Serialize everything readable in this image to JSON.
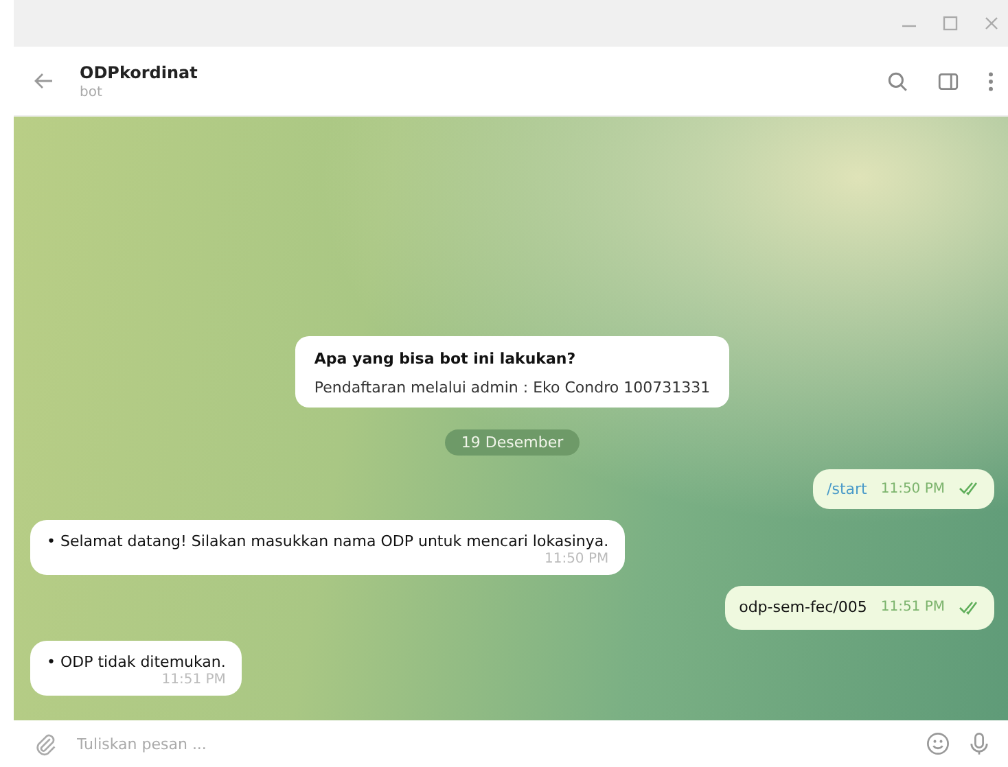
{
  "chat": {
    "name": "ODPkordinat",
    "status": "bot"
  },
  "intro": {
    "title": "Apa yang bisa bot ini lakukan?",
    "text": "Pendaftaran melalui admin : Eko Condro 100731331"
  },
  "date": "19 Desember",
  "messages": [
    {
      "kind": "out",
      "text": "/start",
      "time": "11:50 PM",
      "read": true,
      "command": true
    },
    {
      "kind": "in",
      "text": "• Selamat datang! Silakan masukkan nama ODP untuk mencari lokasinya.",
      "time": "11:50 PM"
    },
    {
      "kind": "out",
      "text": "odp-sem-fec/005",
      "time": "11:51 PM",
      "read": true,
      "command": false
    },
    {
      "kind": "in",
      "text": "• ODP tidak ditemukan.",
      "time": "11:51 PM"
    }
  ],
  "composer": {
    "placeholder": "Tuliskan pesan ..."
  }
}
